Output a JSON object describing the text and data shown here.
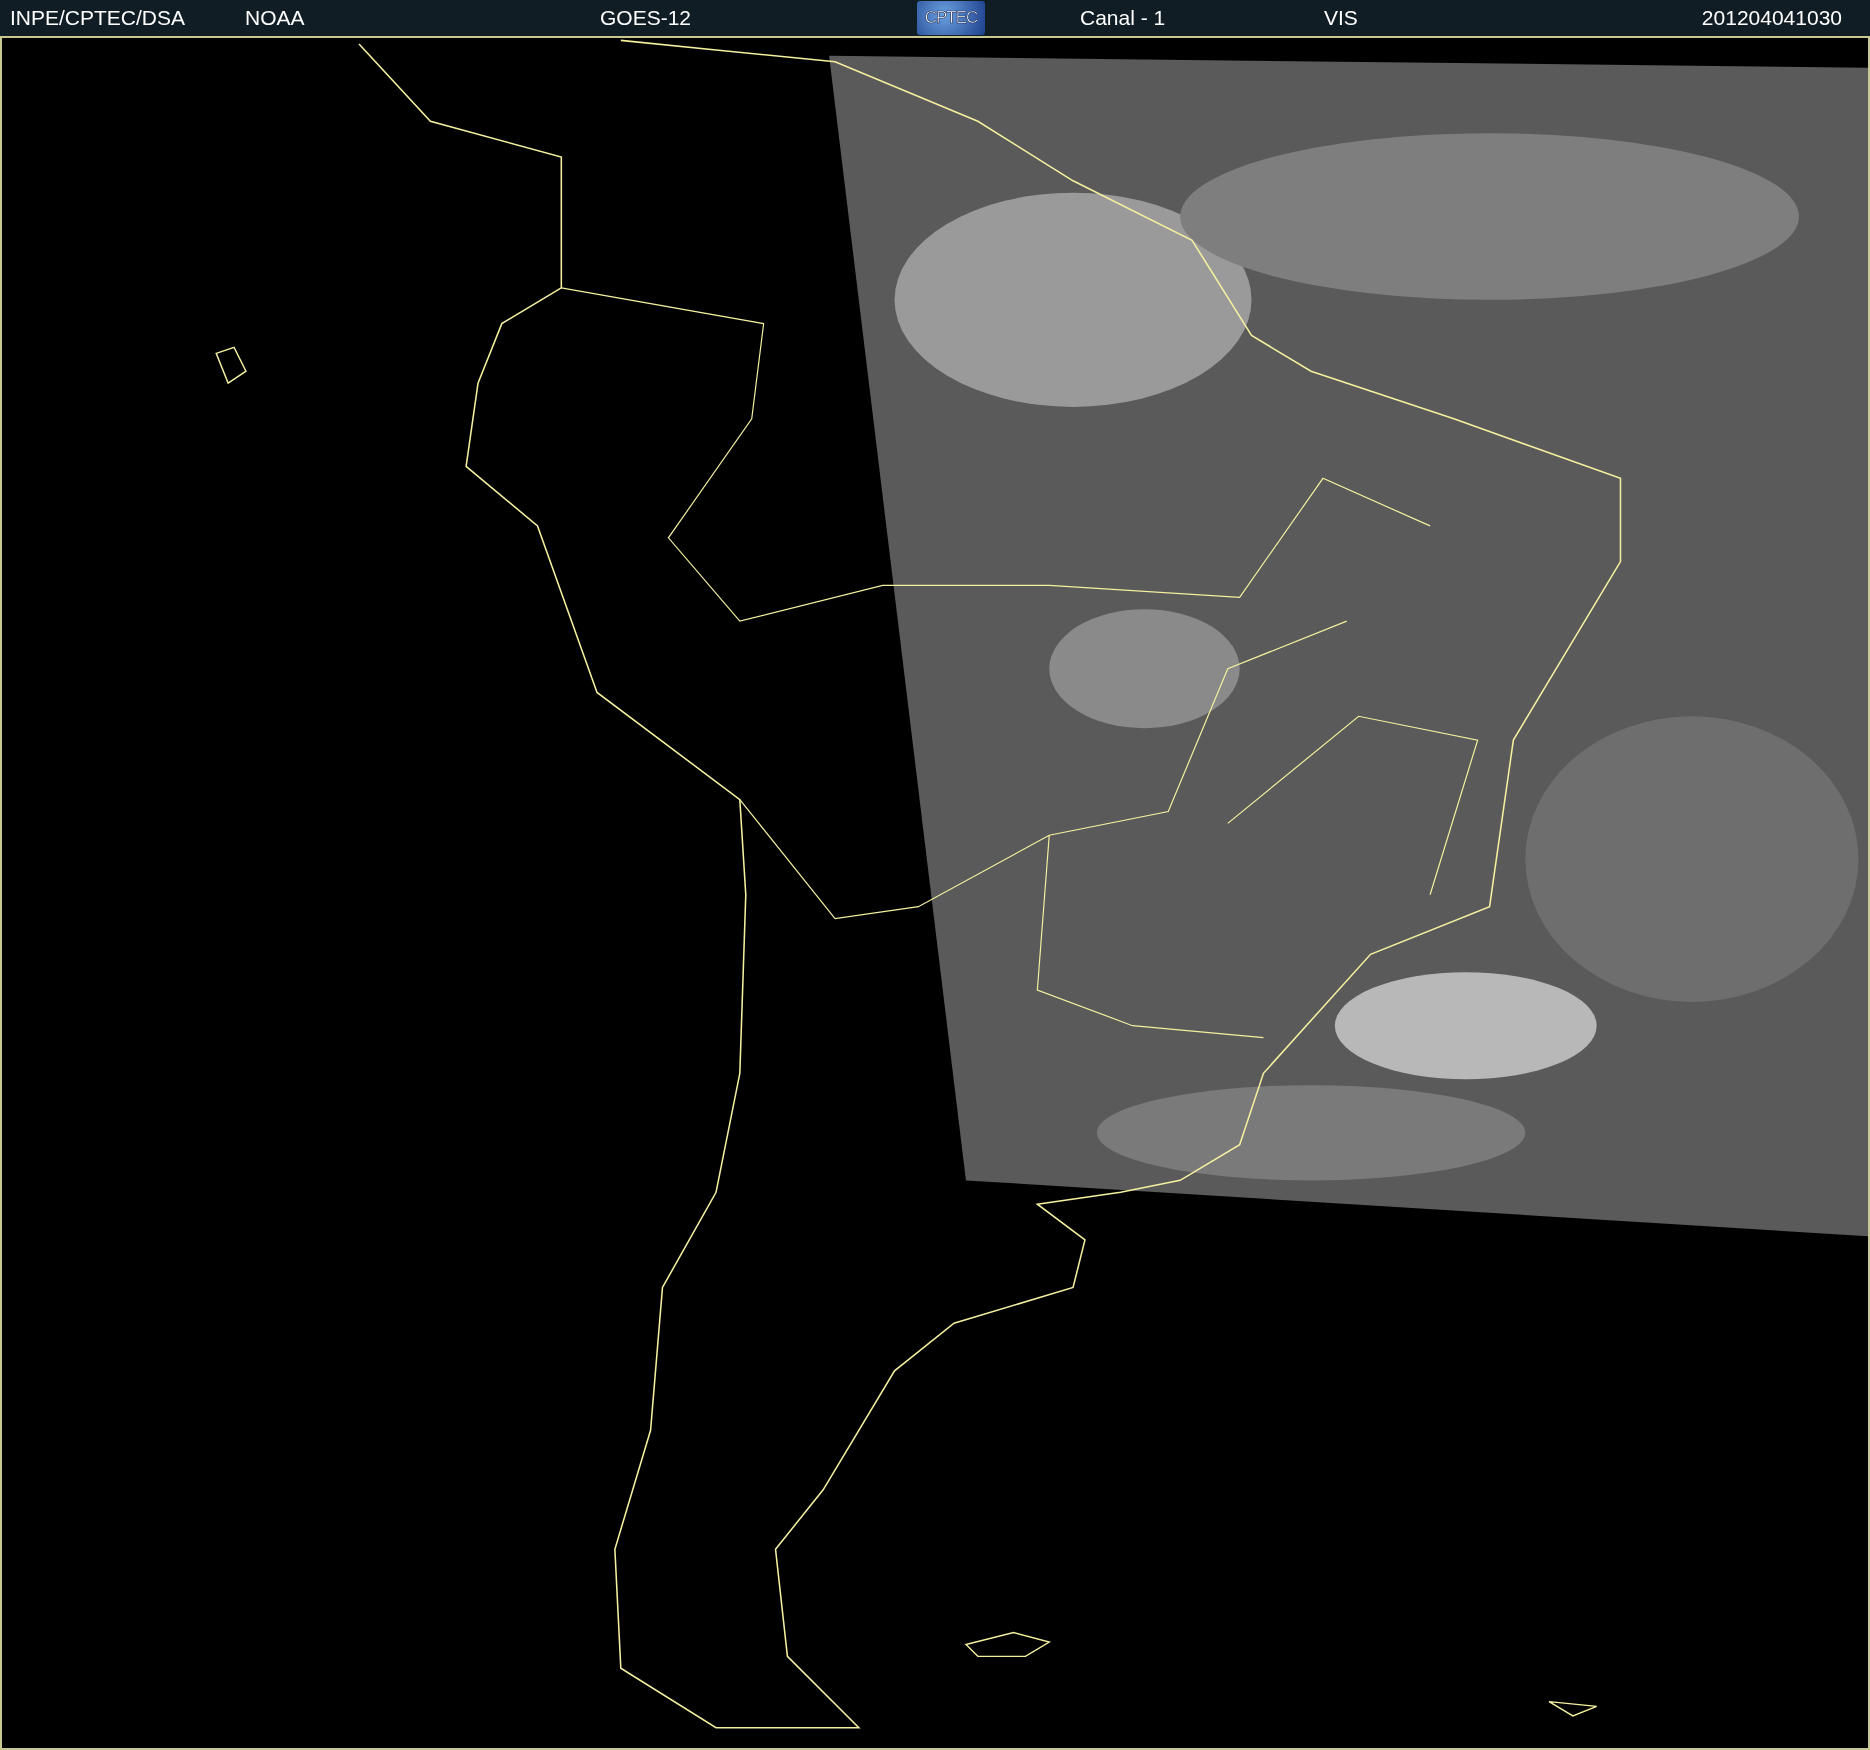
{
  "header": [
    {
      "kind": "text",
      "text": "INPE/CPTEC/DSA"
    },
    {
      "kind": "text",
      "text": "NOAA"
    },
    {
      "kind": "text",
      "text": "GOES-12"
    },
    {
      "kind": "logo",
      "text": "CPTEC"
    },
    {
      "kind": "text",
      "text": "Canal - 1"
    },
    {
      "kind": "text",
      "text": "VIS"
    },
    {
      "kind": "time",
      "text": "201204041030"
    }
  ]
}
